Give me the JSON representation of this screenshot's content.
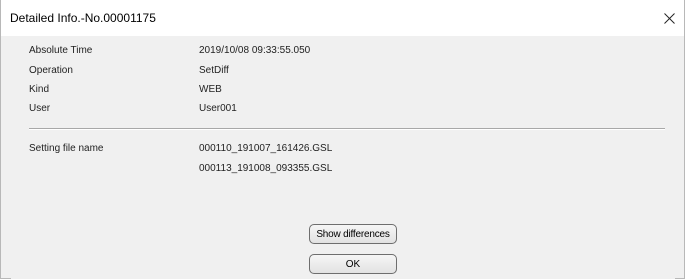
{
  "window": {
    "title": "Detailed Info.-No.00001175",
    "close_glyph": "✕"
  },
  "details": [
    {
      "label": "Absolute Time",
      "value": "2019/10/08 09:33:55.050"
    },
    {
      "label": "Operation",
      "value": "SetDiff"
    },
    {
      "label": "Kind",
      "value": "WEB"
    },
    {
      "label": "User",
      "value": "User001"
    }
  ],
  "setting_files": {
    "label": "Setting file name",
    "files": [
      "000110_191007_161426.GSL",
      "000113_191008_093355.GSL"
    ]
  },
  "buttons": {
    "show_differences": "Show differences",
    "ok": "OK"
  }
}
